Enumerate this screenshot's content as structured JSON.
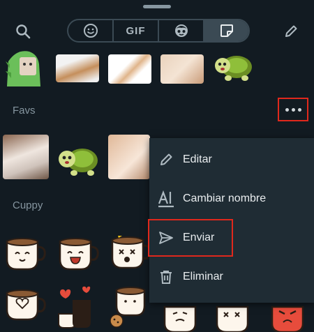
{
  "header": {
    "icons": [
      "search-icon",
      "emoji-icon",
      "gif-tab",
      "avatar-icon",
      "sticker-icon",
      "pencil-icon"
    ],
    "gif_label": "GIF"
  },
  "sections": {
    "favs": {
      "label": "Favs"
    },
    "cuppy": {
      "label": "Cuppy"
    }
  },
  "menu": {
    "items": [
      {
        "label": "Editar",
        "icon": "pencil-icon"
      },
      {
        "label": "Cambiar nombre",
        "icon": "rename-icon"
      },
      {
        "label": "Enviar",
        "icon": "send-icon"
      },
      {
        "label": "Eliminar",
        "icon": "trash-icon"
      }
    ]
  },
  "colors": {
    "background": "#121b22",
    "menu_bg": "#1f2c34",
    "highlight": "#e0281c",
    "accent": "#aebac1"
  }
}
